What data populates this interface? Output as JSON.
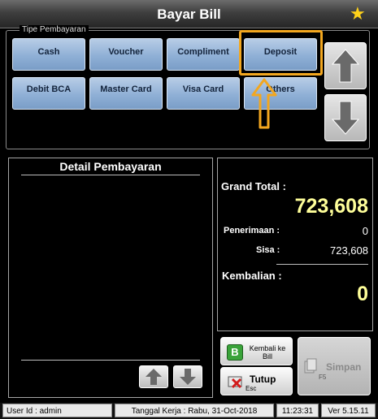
{
  "window": {
    "title": "Bayar Bill"
  },
  "payment_types": {
    "legend": "Tipe Pembayaran",
    "buttons": [
      "Cash",
      "Voucher",
      "Compliment",
      "Deposit",
      "Debit BCA",
      "Master Card",
      "Visa Card",
      "Others"
    ]
  },
  "detail": {
    "title": "Detail Pembayaran"
  },
  "totals": {
    "grand_total_label": "Grand Total :",
    "grand_total_value": "723,608",
    "penerimaan_label": "Penerimaan :",
    "penerimaan_value": "0",
    "sisa_label": "Sisa :",
    "sisa_value": "723,608",
    "kembalian_label": "Kembalian :",
    "kembalian_value": "0"
  },
  "actions": {
    "kembali_icon": "B",
    "kembali_label": "Kembali ke Bill",
    "tutup_label": "Tutup",
    "tutup_shortcut": "Esc",
    "simpan_label": "Simpan",
    "simpan_shortcut": "F5"
  },
  "status": {
    "user": "User Id : admin",
    "tanggal": "Tanggal Kerja : Rabu, 31-Oct-2018",
    "time": "11:23:31",
    "version": "Ver 5.15.11"
  },
  "colors": {
    "highlight": "#f3a71f",
    "button_blue": "#8fb0d6",
    "amount_yellow": "#ffff9a"
  }
}
